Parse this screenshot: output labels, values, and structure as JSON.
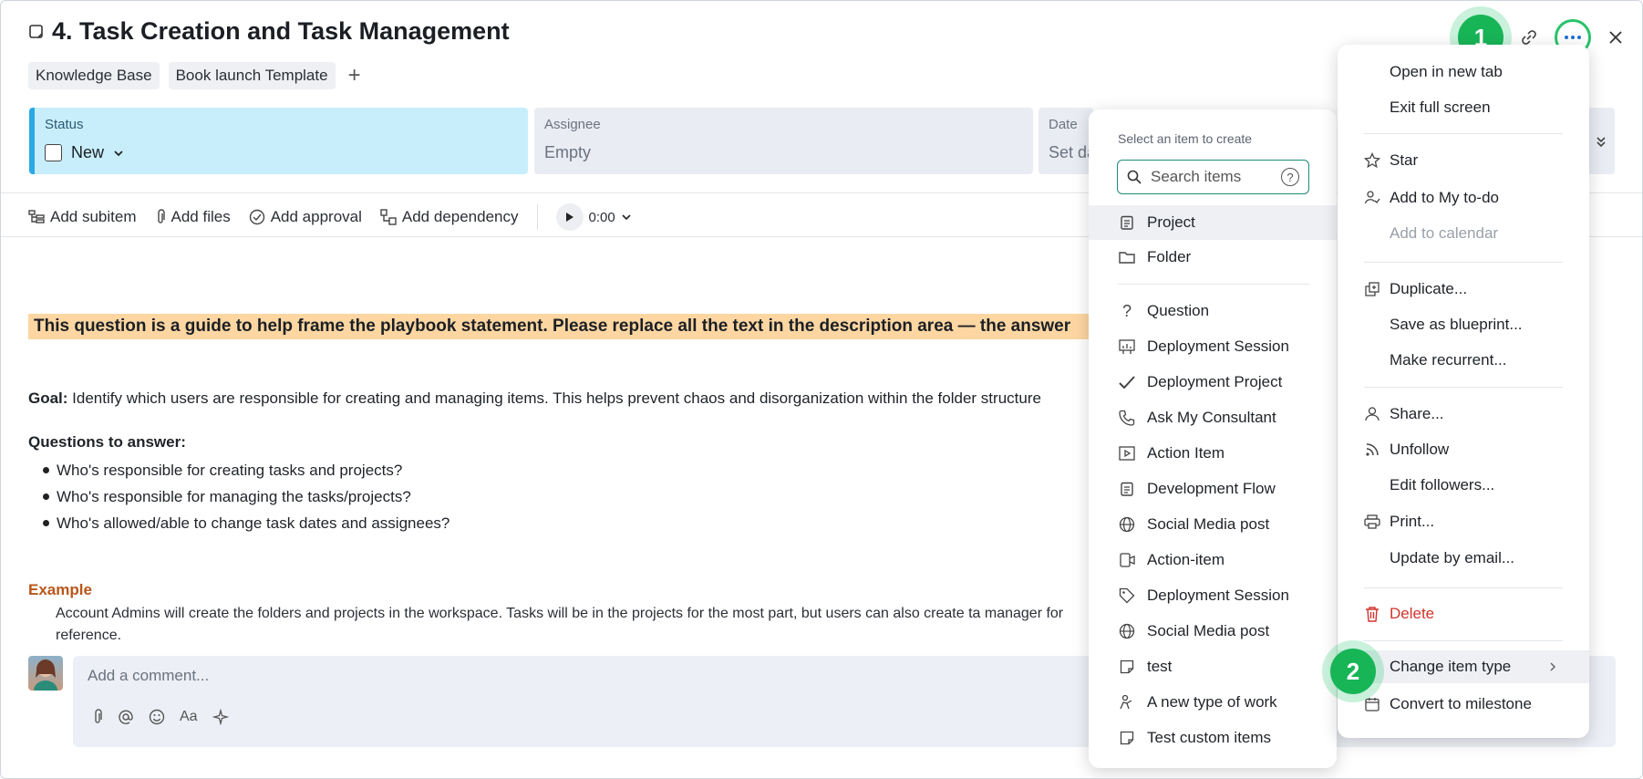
{
  "header": {
    "title": "4. Task Creation and Task Management",
    "tags": [
      "Knowledge Base",
      "Book launch Template"
    ],
    "add_tag": "+"
  },
  "fields": {
    "status": {
      "label": "Status",
      "value": "New",
      "color": "#c8eefc"
    },
    "assignee": {
      "label": "Assignee",
      "value": "Empty"
    },
    "date": {
      "label": "Date",
      "value": "Set dates"
    }
  },
  "toolbar": {
    "add_subitem": "Add subitem",
    "add_files": "Add files",
    "add_approval": "Add approval",
    "add_dependency": "Add dependency",
    "timer": "0:00"
  },
  "content": {
    "highlight": "This question is a guide to help frame the playbook statement. Please replace all the text in the description area — the answer",
    "goal_label": "Goal:",
    "goal_text": " Identify which users are responsible for creating and managing items. This helps prevent chaos and disorganization within the folder structure",
    "questions_heading": "Questions to answer:",
    "questions": [
      "Who's responsible for creating tasks and projects?",
      "Who's responsible for managing the tasks/projects?",
      "Who's allowed/able to change task dates and assignees?"
    ],
    "example_heading": "Example",
    "example_text": "Account Admins will create the folders and projects in the workspace. Tasks will be in the projects for the most part, but users can also create ta manager for reference."
  },
  "comment": {
    "placeholder": "Add a comment..."
  },
  "create_menu": {
    "heading": "Select an item to create",
    "search_placeholder": "Search items",
    "help": "?",
    "primary": [
      {
        "label": "Project",
        "icon": "project-icon"
      },
      {
        "label": "Folder",
        "icon": "folder-icon"
      }
    ],
    "custom": [
      {
        "label": "Question",
        "icon": "question-icon"
      },
      {
        "label": "Deployment Session",
        "icon": "presentation-icon"
      },
      {
        "label": "Deployment Project",
        "icon": "check-icon"
      },
      {
        "label": "Ask My Consultant",
        "icon": "phone-icon"
      },
      {
        "label": "Action Item",
        "icon": "video-icon"
      },
      {
        "label": "Development Flow",
        "icon": "clipboard-icon"
      },
      {
        "label": "Social Media post",
        "icon": "globe-icon"
      },
      {
        "label": "Action-item",
        "icon": "device-icon"
      },
      {
        "label": "Deployment Session",
        "icon": "tag-icon"
      },
      {
        "label": "Social Media post",
        "icon": "globe-icon"
      },
      {
        "label": "test",
        "icon": "note-icon"
      },
      {
        "label": "A new type of work",
        "icon": "person-icon"
      },
      {
        "label": "Test custom items",
        "icon": "note-icon"
      }
    ]
  },
  "more_menu": {
    "open_new_tab": "Open in new tab",
    "exit_full_screen": "Exit full screen",
    "star": "Star",
    "add_todo": "Add to My to-do",
    "add_calendar": "Add to calendar",
    "duplicate": "Duplicate...",
    "save_blueprint": "Save as blueprint...",
    "make_recurrent": "Make recurrent...",
    "share": "Share...",
    "unfollow": "Unfollow",
    "edit_followers": "Edit followers...",
    "print": "Print...",
    "update_email": "Update by email...",
    "delete": "Delete",
    "change_type": "Change item type",
    "convert_milestone": "Convert to milestone"
  },
  "badges": {
    "step1": "1",
    "step2": "2"
  },
  "colors": {
    "accent_green": "#18b557",
    "danger": "#d0342c",
    "highlight": "#fdd6a2",
    "example": "#b9561a"
  }
}
